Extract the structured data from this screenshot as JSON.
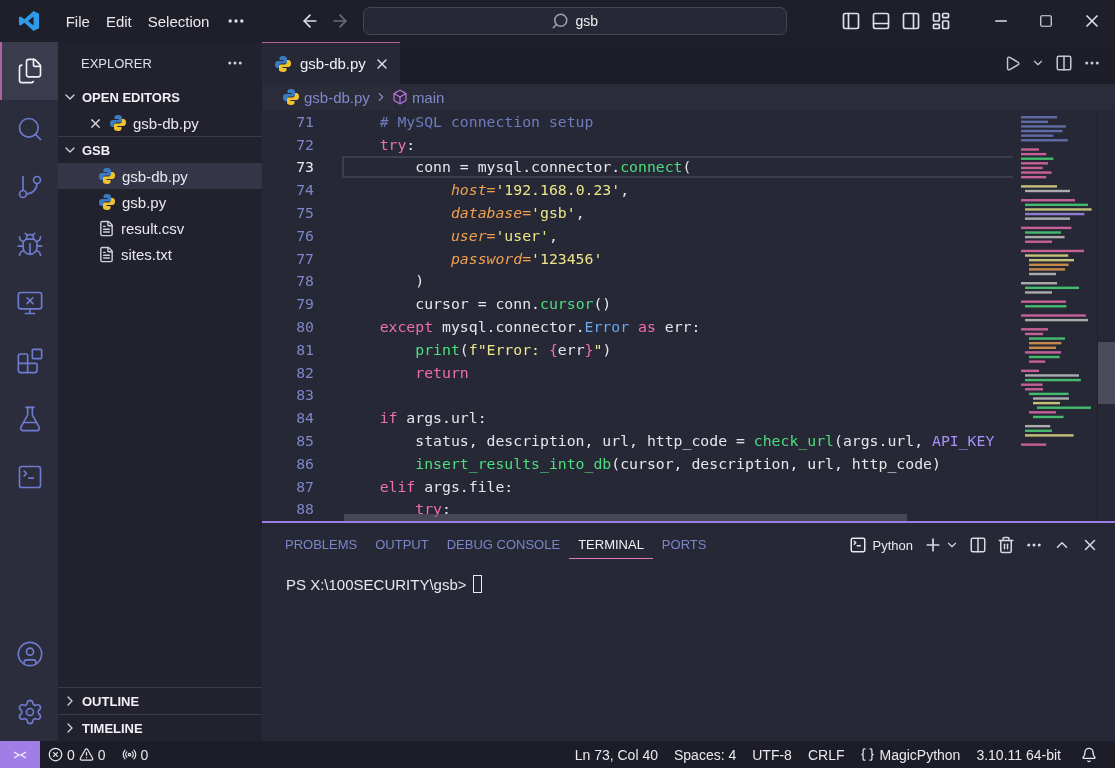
{
  "title_bar": {
    "menu": [
      {
        "label": "File"
      },
      {
        "label": "Edit"
      },
      {
        "label": "Selection"
      }
    ],
    "search": "gsb"
  },
  "activity_bar": {
    "items": [
      {
        "kind": "explorer",
        "selected": true
      },
      {
        "kind": "search",
        "selected": false
      },
      {
        "kind": "source-control",
        "selected": false
      },
      {
        "kind": "debug",
        "selected": false
      },
      {
        "kind": "remote",
        "selected": false
      },
      {
        "kind": "extensions",
        "selected": false
      },
      {
        "kind": "testing",
        "selected": false
      },
      {
        "kind": "terminal",
        "selected": false
      }
    ],
    "bottom": [
      {
        "kind": "account"
      },
      {
        "kind": "settings"
      }
    ]
  },
  "sidebar": {
    "title": "EXPLORER",
    "sections": [
      {
        "label": "OPEN EDITORS",
        "expanded": true,
        "items": [
          {
            "name": "gsb-db.py",
            "kind": "python",
            "closable": true,
            "selected": false
          }
        ]
      },
      {
        "label": "GSB",
        "expanded": true,
        "items": [
          {
            "name": "gsb-db.py",
            "kind": "python",
            "closable": false,
            "selected": true
          },
          {
            "name": "gsb.py",
            "kind": "python",
            "closable": false,
            "selected": false
          },
          {
            "name": "result.csv",
            "kind": "text",
            "closable": false,
            "selected": false
          },
          {
            "name": "sites.txt",
            "kind": "text",
            "closable": false,
            "selected": false
          }
        ]
      }
    ],
    "footer_sections": [
      {
        "label": "OUTLINE",
        "expanded": false
      },
      {
        "label": "TIMELINE",
        "expanded": false
      }
    ]
  },
  "editor": {
    "tabs": [
      {
        "label": "gsb-db.py",
        "selected": true
      }
    ],
    "breadcrumb": [
      {
        "label": "gsb-db.py",
        "kind": "python"
      },
      {
        "label": "main",
        "kind": "symbol"
      }
    ],
    "lines": [
      {
        "number": "71",
        "current": false,
        "tokens": [
          {
            "kind": "comment",
            "text": "    # MySQL connection setup"
          }
        ]
      },
      {
        "number": "72",
        "current": false,
        "tokens": [
          {
            "kind": "kw",
            "text": "    try"
          },
          {
            "kind": "plain",
            "text": ":"
          }
        ]
      },
      {
        "number": "73",
        "current": true,
        "tokens": [
          {
            "kind": "plain",
            "text": "        conn = mysql.connector."
          },
          {
            "kind": "fn",
            "text": "connect"
          },
          {
            "kind": "plain",
            "text": "("
          }
        ]
      },
      {
        "number": "74",
        "current": false,
        "tokens": [
          {
            "kind": "param",
            "text": "            host="
          },
          {
            "kind": "str",
            "text": "'192.168.0.23'"
          },
          {
            "kind": "plain",
            "text": ","
          }
        ]
      },
      {
        "number": "75",
        "current": false,
        "tokens": [
          {
            "kind": "param",
            "text": "            database="
          },
          {
            "kind": "str",
            "text": "'gsb'"
          },
          {
            "kind": "plain",
            "text": ","
          }
        ]
      },
      {
        "number": "76",
        "current": false,
        "tokens": [
          {
            "kind": "param",
            "text": "            user="
          },
          {
            "kind": "str",
            "text": "'user'"
          },
          {
            "kind": "plain",
            "text": ","
          }
        ]
      },
      {
        "number": "77",
        "current": false,
        "tokens": [
          {
            "kind": "param",
            "text": "            password="
          },
          {
            "kind": "str",
            "text": "'123456'"
          }
        ]
      },
      {
        "number": "78",
        "current": false,
        "tokens": [
          {
            "kind": "plain",
            "text": "        )"
          }
        ]
      },
      {
        "number": "79",
        "current": false,
        "tokens": [
          {
            "kind": "plain",
            "text": "        cursor = conn."
          },
          {
            "kind": "fn",
            "text": "cursor"
          },
          {
            "kind": "plain",
            "text": "()"
          }
        ]
      },
      {
        "number": "80",
        "current": false,
        "tokens": [
          {
            "kind": "kw",
            "text": "    except"
          },
          {
            "kind": "plain",
            "text": " mysql.connector."
          },
          {
            "kind": "cls",
            "text": "Error"
          },
          {
            "kind": "kw",
            "text": " as"
          },
          {
            "kind": "plain",
            "text": " err:"
          }
        ]
      },
      {
        "number": "81",
        "current": false,
        "tokens": [
          {
            "kind": "fn",
            "text": "        print"
          },
          {
            "kind": "plain",
            "text": "("
          },
          {
            "kind": "str",
            "text": "f\"Error: "
          },
          {
            "kind": "kw",
            "text": "{"
          },
          {
            "kind": "plain",
            "text": "err"
          },
          {
            "kind": "kw",
            "text": "}"
          },
          {
            "kind": "str",
            "text": "\""
          },
          {
            "kind": "plain",
            "text": ")"
          }
        ]
      },
      {
        "number": "82",
        "current": false,
        "tokens": [
          {
            "kind": "kw",
            "text": "        return"
          }
        ]
      },
      {
        "number": "83",
        "current": false
      },
      {
        "number": "84",
        "current": false,
        "tokens": [
          {
            "kind": "kw",
            "text": "    if"
          },
          {
            "kind": "plain",
            "text": " args.url:"
          }
        ]
      },
      {
        "number": "85",
        "current": false,
        "tokens": [
          {
            "kind": "plain",
            "text": "        status, description, url, http_code = "
          },
          {
            "kind": "fn",
            "text": "check_url"
          },
          {
            "kind": "plain",
            "text": "(args.url, "
          },
          {
            "kind": "const",
            "text": "API_KEY"
          }
        ]
      },
      {
        "number": "86",
        "current": false,
        "tokens": [
          {
            "kind": "fn",
            "text": "        insert_results_into_db"
          },
          {
            "kind": "plain",
            "text": "(cursor, description, url, http_code)"
          }
        ]
      },
      {
        "number": "87",
        "current": false,
        "tokens": [
          {
            "kind": "kw",
            "text": "    elif"
          },
          {
            "kind": "plain",
            "text": " args.file:"
          }
        ]
      },
      {
        "number": "88",
        "current": false,
        "tokens": [
          {
            "kind": "kw",
            "text": "        try"
          },
          {
            "kind": "plain",
            "text": ":"
          }
        ]
      }
    ]
  },
  "panel": {
    "tabs": [
      {
        "label": "PROBLEMS",
        "selected": false
      },
      {
        "label": "OUTPUT",
        "selected": false
      },
      {
        "label": "DEBUG CONSOLE",
        "selected": false
      },
      {
        "label": "TERMINAL",
        "selected": true
      },
      {
        "label": "PORTS",
        "selected": false
      }
    ],
    "shell": "Python",
    "prompt": "PS X:\\100SECURITY\\gsb>"
  },
  "status_bar": {
    "errors": "0",
    "warnings": "0",
    "ports": "0",
    "items": [
      {
        "kind": "plain",
        "text": "Ln 73, Col 40"
      },
      {
        "kind": "plain",
        "text": "Spaces: 4"
      },
      {
        "kind": "plain",
        "text": "UTF-8"
      },
      {
        "kind": "plain",
        "text": "CRLF"
      },
      {
        "kind": "language",
        "text": "MagicPython"
      },
      {
        "kind": "plain",
        "text": "3.10.11 64-bit"
      }
    ]
  }
}
